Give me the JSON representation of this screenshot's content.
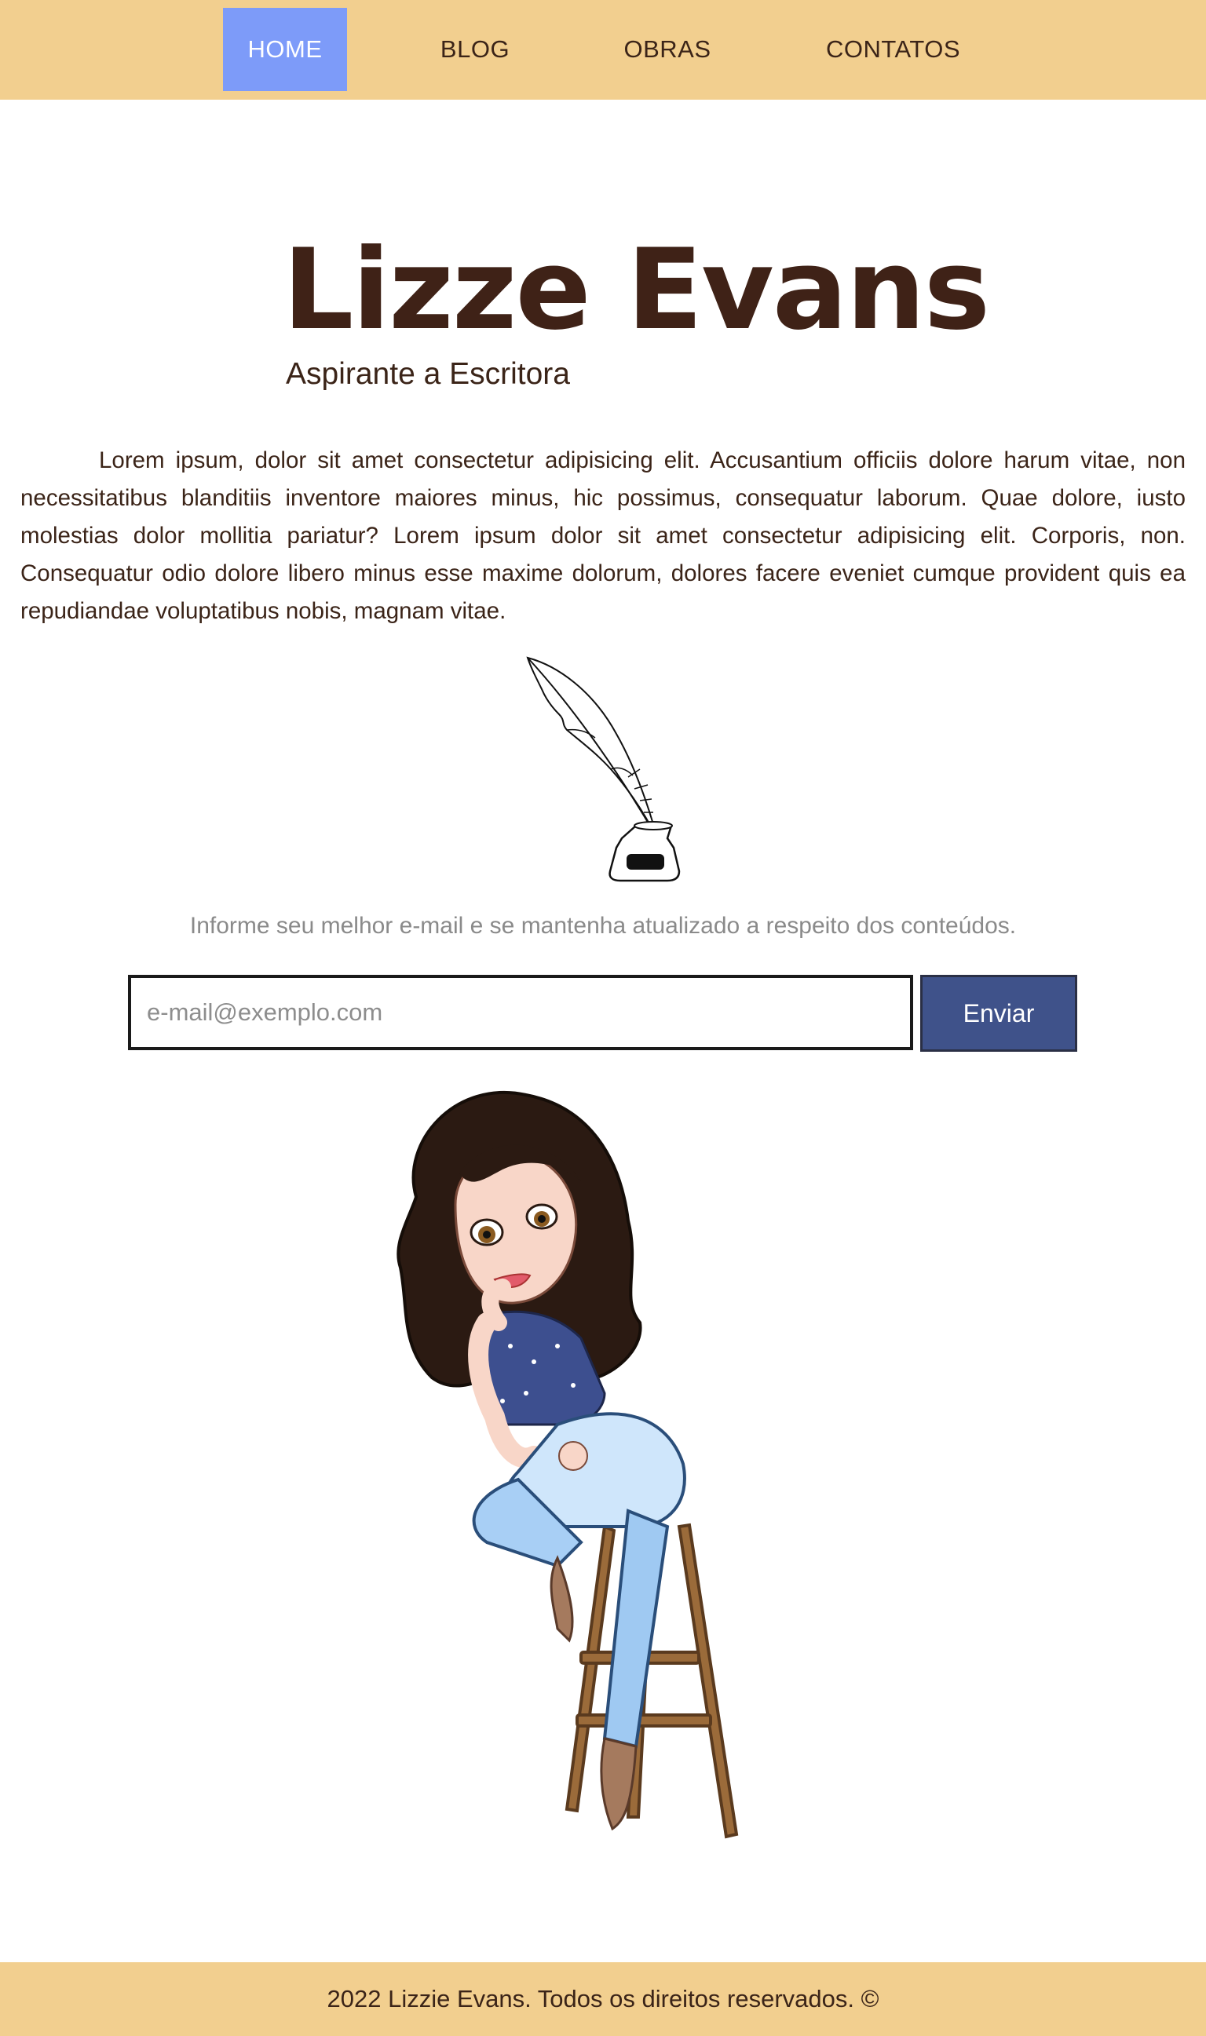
{
  "nav": {
    "items": [
      {
        "label": "HOME",
        "active": true
      },
      {
        "label": "BLOG",
        "active": false
      },
      {
        "label": "OBRAS",
        "active": false
      },
      {
        "label": "CONTATOS",
        "active": false
      }
    ]
  },
  "hero": {
    "title": "Lizze Evans",
    "subtitle": "Aspirante a Escritora"
  },
  "intro": {
    "text": "Lorem ipsum, dolor sit amet consectetur adipisicing elit. Accusantium officiis dolore harum vitae, non necessitatibus blanditiis inventore maiores minus, hic possimus, consequatur laborum. Quae dolore, iusto molestias dolor mollitia pariatur? Lorem ipsum dolor sit amet consectetur adipisicing elit. Corporis, non. Consequatur odio dolore libero minus esse maxime dolorum, dolores facere eveniet cumque provident quis ea repudiandae voluptatibus nobis, magnam vitae."
  },
  "newsletter": {
    "hint": "Informe seu melhor e-mail e se mantenha atualizado a respeito dos conteúdos.",
    "placeholder": "e-mail@exemplo.com",
    "value": "",
    "button_label": "Enviar"
  },
  "icons": {
    "quill": "quill-inkwell-icon",
    "avatar": "author-avatar-illustration"
  },
  "colors": {
    "topbar": "#f2cf8f",
    "nav_active": "#7d9bf9",
    "button": "#3f528a",
    "text": "#3b2418"
  },
  "footer": {
    "text": "2022 Lizzie Evans. Todos os direitos reservados. ©"
  }
}
